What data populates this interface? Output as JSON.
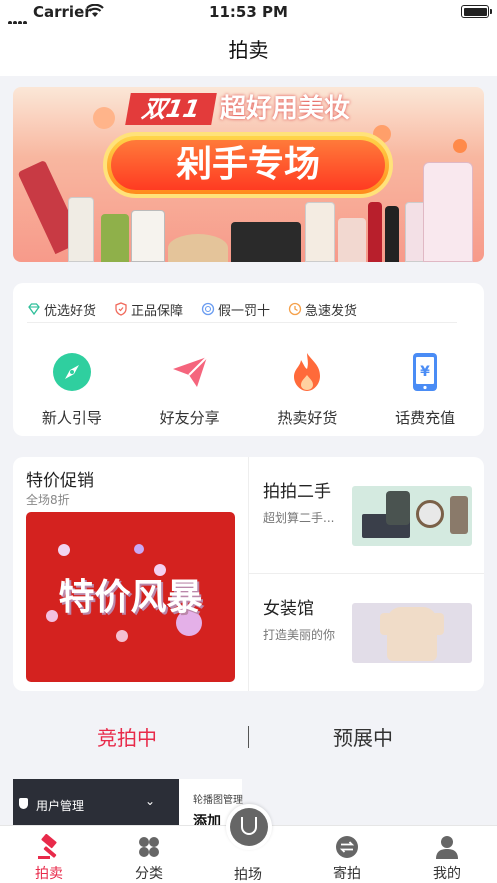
{
  "status": {
    "carrier": "Carrier",
    "time": "11:53 PM"
  },
  "nav": {
    "title": "拍卖"
  },
  "banner": {
    "tag": "双11",
    "headline": "超好用美妆",
    "main": "剁手专场"
  },
  "guarantees": [
    {
      "label": "优选好货",
      "icon": "diamond-icon",
      "color": "#2fbf9a"
    },
    {
      "label": "正品保障",
      "icon": "shield-icon",
      "color": "#f06a5c"
    },
    {
      "label": "假一罚十",
      "icon": "badge-icon",
      "color": "#6a9cf0"
    },
    {
      "label": "急速发货",
      "icon": "clock-icon",
      "color": "#f5a04a"
    }
  ],
  "quick_links": [
    {
      "label": "新人引导",
      "icon": "compass-icon",
      "color": "#2fcf9f"
    },
    {
      "label": "好友分享",
      "icon": "paper-plane-icon",
      "color": "#f5657d"
    },
    {
      "label": "热卖好货",
      "icon": "flame-icon",
      "color": "#ff6a3a"
    },
    {
      "label": "话费充值",
      "icon": "phone-yuan-icon",
      "color": "#4a8cf5"
    }
  ],
  "promo": {
    "title": "特价促销",
    "subtitle": "全场8折",
    "poster_text": "特价风暴",
    "sections": [
      {
        "title": "拍拍二手",
        "subtitle": "超划算二手..."
      },
      {
        "title": "女装馆",
        "subtitle": "打造美丽的你"
      }
    ]
  },
  "tabs": {
    "active": "竞拍中",
    "inactive": "预展中"
  },
  "preview": {
    "menu_label": "用户管理",
    "chevron": "⌄",
    "panel_label": "轮播图管理",
    "panel_text": "添加"
  },
  "tabbar": [
    {
      "label": "拍卖",
      "icon": "gavel-icon"
    },
    {
      "label": "分类",
      "icon": "grid-icon"
    },
    {
      "label": "拍场",
      "icon": "bag-icon"
    },
    {
      "label": "寄拍",
      "icon": "exchange-icon"
    },
    {
      "label": "我的",
      "icon": "person-icon"
    }
  ],
  "colors": {
    "accent": "#e82a4a"
  }
}
